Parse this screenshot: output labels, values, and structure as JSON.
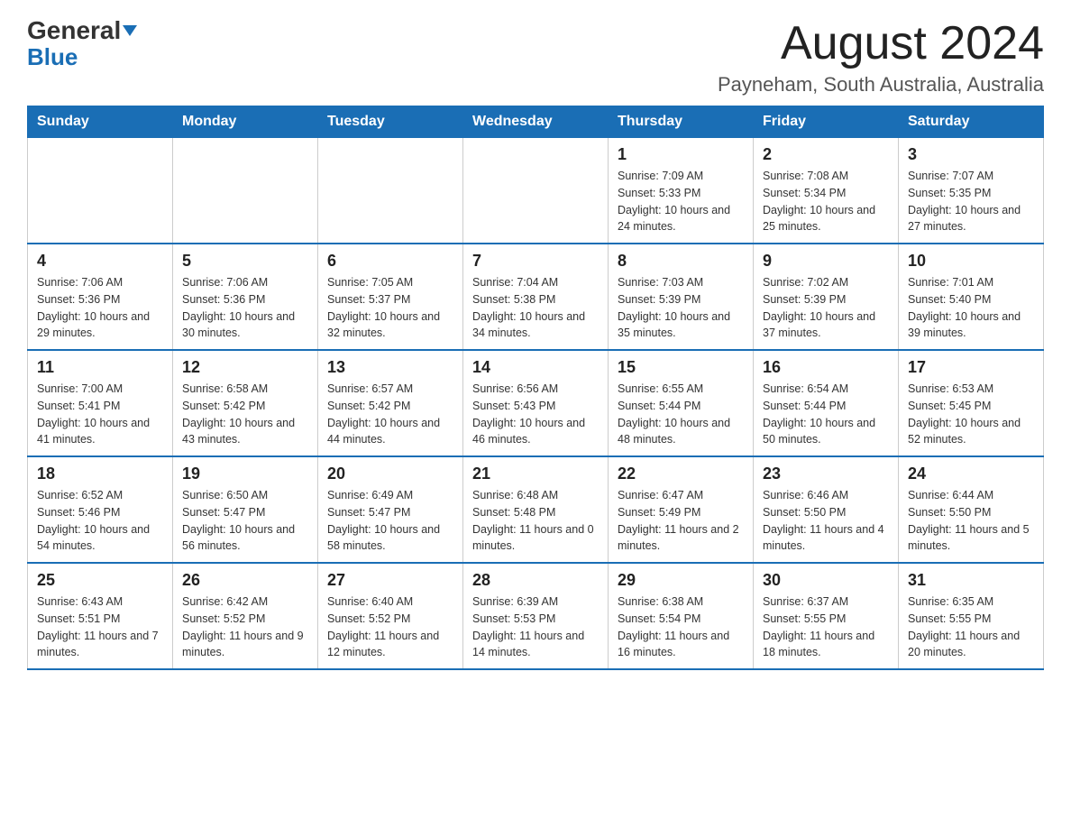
{
  "header": {
    "logo_general": "General",
    "logo_blue": "Blue",
    "month": "August 2024",
    "location": "Payneham, South Australia, Australia"
  },
  "weekdays": [
    "Sunday",
    "Monday",
    "Tuesday",
    "Wednesday",
    "Thursday",
    "Friday",
    "Saturday"
  ],
  "weeks": [
    [
      {
        "day": "",
        "sunrise": "",
        "sunset": "",
        "daylight": ""
      },
      {
        "day": "",
        "sunrise": "",
        "sunset": "",
        "daylight": ""
      },
      {
        "day": "",
        "sunrise": "",
        "sunset": "",
        "daylight": ""
      },
      {
        "day": "",
        "sunrise": "",
        "sunset": "",
        "daylight": ""
      },
      {
        "day": "1",
        "sunrise": "Sunrise: 7:09 AM",
        "sunset": "Sunset: 5:33 PM",
        "daylight": "Daylight: 10 hours and 24 minutes."
      },
      {
        "day": "2",
        "sunrise": "Sunrise: 7:08 AM",
        "sunset": "Sunset: 5:34 PM",
        "daylight": "Daylight: 10 hours and 25 minutes."
      },
      {
        "day": "3",
        "sunrise": "Sunrise: 7:07 AM",
        "sunset": "Sunset: 5:35 PM",
        "daylight": "Daylight: 10 hours and 27 minutes."
      }
    ],
    [
      {
        "day": "4",
        "sunrise": "Sunrise: 7:06 AM",
        "sunset": "Sunset: 5:36 PM",
        "daylight": "Daylight: 10 hours and 29 minutes."
      },
      {
        "day": "5",
        "sunrise": "Sunrise: 7:06 AM",
        "sunset": "Sunset: 5:36 PM",
        "daylight": "Daylight: 10 hours and 30 minutes."
      },
      {
        "day": "6",
        "sunrise": "Sunrise: 7:05 AM",
        "sunset": "Sunset: 5:37 PM",
        "daylight": "Daylight: 10 hours and 32 minutes."
      },
      {
        "day": "7",
        "sunrise": "Sunrise: 7:04 AM",
        "sunset": "Sunset: 5:38 PM",
        "daylight": "Daylight: 10 hours and 34 minutes."
      },
      {
        "day": "8",
        "sunrise": "Sunrise: 7:03 AM",
        "sunset": "Sunset: 5:39 PM",
        "daylight": "Daylight: 10 hours and 35 minutes."
      },
      {
        "day": "9",
        "sunrise": "Sunrise: 7:02 AM",
        "sunset": "Sunset: 5:39 PM",
        "daylight": "Daylight: 10 hours and 37 minutes."
      },
      {
        "day": "10",
        "sunrise": "Sunrise: 7:01 AM",
        "sunset": "Sunset: 5:40 PM",
        "daylight": "Daylight: 10 hours and 39 minutes."
      }
    ],
    [
      {
        "day": "11",
        "sunrise": "Sunrise: 7:00 AM",
        "sunset": "Sunset: 5:41 PM",
        "daylight": "Daylight: 10 hours and 41 minutes."
      },
      {
        "day": "12",
        "sunrise": "Sunrise: 6:58 AM",
        "sunset": "Sunset: 5:42 PM",
        "daylight": "Daylight: 10 hours and 43 minutes."
      },
      {
        "day": "13",
        "sunrise": "Sunrise: 6:57 AM",
        "sunset": "Sunset: 5:42 PM",
        "daylight": "Daylight: 10 hours and 44 minutes."
      },
      {
        "day": "14",
        "sunrise": "Sunrise: 6:56 AM",
        "sunset": "Sunset: 5:43 PM",
        "daylight": "Daylight: 10 hours and 46 minutes."
      },
      {
        "day": "15",
        "sunrise": "Sunrise: 6:55 AM",
        "sunset": "Sunset: 5:44 PM",
        "daylight": "Daylight: 10 hours and 48 minutes."
      },
      {
        "day": "16",
        "sunrise": "Sunrise: 6:54 AM",
        "sunset": "Sunset: 5:44 PM",
        "daylight": "Daylight: 10 hours and 50 minutes."
      },
      {
        "day": "17",
        "sunrise": "Sunrise: 6:53 AM",
        "sunset": "Sunset: 5:45 PM",
        "daylight": "Daylight: 10 hours and 52 minutes."
      }
    ],
    [
      {
        "day": "18",
        "sunrise": "Sunrise: 6:52 AM",
        "sunset": "Sunset: 5:46 PM",
        "daylight": "Daylight: 10 hours and 54 minutes."
      },
      {
        "day": "19",
        "sunrise": "Sunrise: 6:50 AM",
        "sunset": "Sunset: 5:47 PM",
        "daylight": "Daylight: 10 hours and 56 minutes."
      },
      {
        "day": "20",
        "sunrise": "Sunrise: 6:49 AM",
        "sunset": "Sunset: 5:47 PM",
        "daylight": "Daylight: 10 hours and 58 minutes."
      },
      {
        "day": "21",
        "sunrise": "Sunrise: 6:48 AM",
        "sunset": "Sunset: 5:48 PM",
        "daylight": "Daylight: 11 hours and 0 minutes."
      },
      {
        "day": "22",
        "sunrise": "Sunrise: 6:47 AM",
        "sunset": "Sunset: 5:49 PM",
        "daylight": "Daylight: 11 hours and 2 minutes."
      },
      {
        "day": "23",
        "sunrise": "Sunrise: 6:46 AM",
        "sunset": "Sunset: 5:50 PM",
        "daylight": "Daylight: 11 hours and 4 minutes."
      },
      {
        "day": "24",
        "sunrise": "Sunrise: 6:44 AM",
        "sunset": "Sunset: 5:50 PM",
        "daylight": "Daylight: 11 hours and 5 minutes."
      }
    ],
    [
      {
        "day": "25",
        "sunrise": "Sunrise: 6:43 AM",
        "sunset": "Sunset: 5:51 PM",
        "daylight": "Daylight: 11 hours and 7 minutes."
      },
      {
        "day": "26",
        "sunrise": "Sunrise: 6:42 AM",
        "sunset": "Sunset: 5:52 PM",
        "daylight": "Daylight: 11 hours and 9 minutes."
      },
      {
        "day": "27",
        "sunrise": "Sunrise: 6:40 AM",
        "sunset": "Sunset: 5:52 PM",
        "daylight": "Daylight: 11 hours and 12 minutes."
      },
      {
        "day": "28",
        "sunrise": "Sunrise: 6:39 AM",
        "sunset": "Sunset: 5:53 PM",
        "daylight": "Daylight: 11 hours and 14 minutes."
      },
      {
        "day": "29",
        "sunrise": "Sunrise: 6:38 AM",
        "sunset": "Sunset: 5:54 PM",
        "daylight": "Daylight: 11 hours and 16 minutes."
      },
      {
        "day": "30",
        "sunrise": "Sunrise: 6:37 AM",
        "sunset": "Sunset: 5:55 PM",
        "daylight": "Daylight: 11 hours and 18 minutes."
      },
      {
        "day": "31",
        "sunrise": "Sunrise: 6:35 AM",
        "sunset": "Sunset: 5:55 PM",
        "daylight": "Daylight: 11 hours and 20 minutes."
      }
    ]
  ]
}
